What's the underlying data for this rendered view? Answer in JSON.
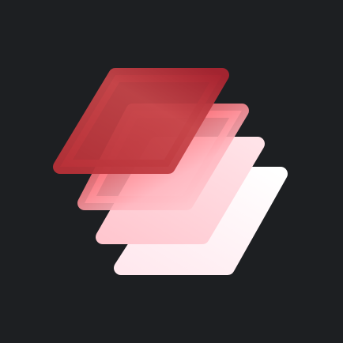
{
  "app_icon": {
    "icon_name": "stacked-layers-icon",
    "colors": {
      "background": "#1d1f22",
      "layer_top": "#c0353b",
      "layer_top_dark": "#a82430",
      "layer_second_light": "#ff6f77",
      "layer_second_soft": "#ffb9c0",
      "layer_third": "#ffd7dd",
      "layer_bottom": "#fff4f6"
    }
  }
}
